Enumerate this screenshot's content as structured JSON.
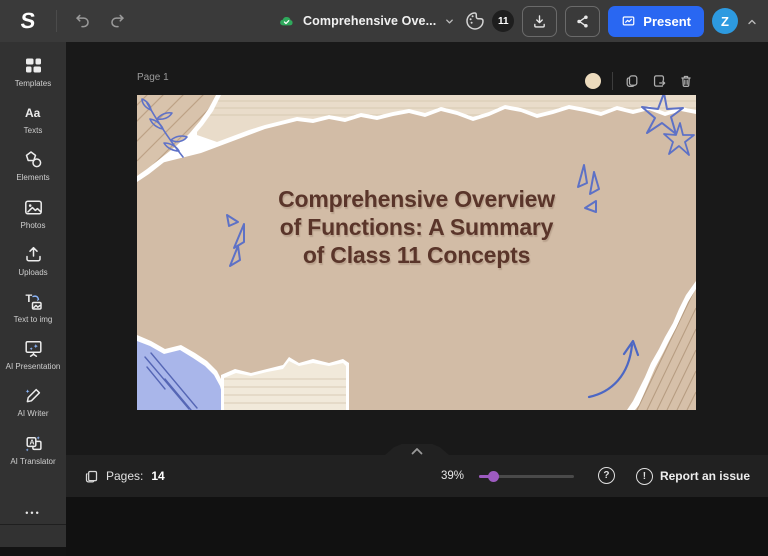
{
  "topbar": {
    "logo_glyph": "S",
    "doc_title": "Comprehensive Ove...",
    "palette_badge": "11",
    "present_label": "Present",
    "avatar_initial": "Z"
  },
  "sidebar": {
    "items": [
      {
        "label": "Templates"
      },
      {
        "label": "Texts"
      },
      {
        "label": "Elements"
      },
      {
        "label": "Photos"
      },
      {
        "label": "Uploads"
      },
      {
        "label": "Text to img"
      },
      {
        "label": "AI Presentation"
      },
      {
        "label": "AI Writer"
      },
      {
        "label": "AI Translator"
      }
    ],
    "more_glyph": "•••",
    "texts_glyph": "Aa",
    "text_to_img_glyph": "T",
    "translator_glyph": "A"
  },
  "canvas": {
    "page_label": "Page 1",
    "slide": {
      "title_lines": {
        "0": "Comprehensive Overview",
        "1": "of Functions: A Summary",
        "2": "of Class 11 Concepts"
      }
    }
  },
  "bottombar": {
    "pages_label": "Pages:",
    "pages_count": "14",
    "zoom_value": "39%",
    "help_glyph": "?",
    "report_glyph": "!",
    "report_label": "Report an issue"
  },
  "colors": {
    "accent_blue": "#2967f2",
    "avatar_blue": "#2d9ae0",
    "saved_green": "#2fa95c",
    "slider_purple": "#9d5bc0",
    "slide_tan": "#d2bca6",
    "slide_title_brown": "#5a352a",
    "doodle_blue": "#5d71c6"
  }
}
